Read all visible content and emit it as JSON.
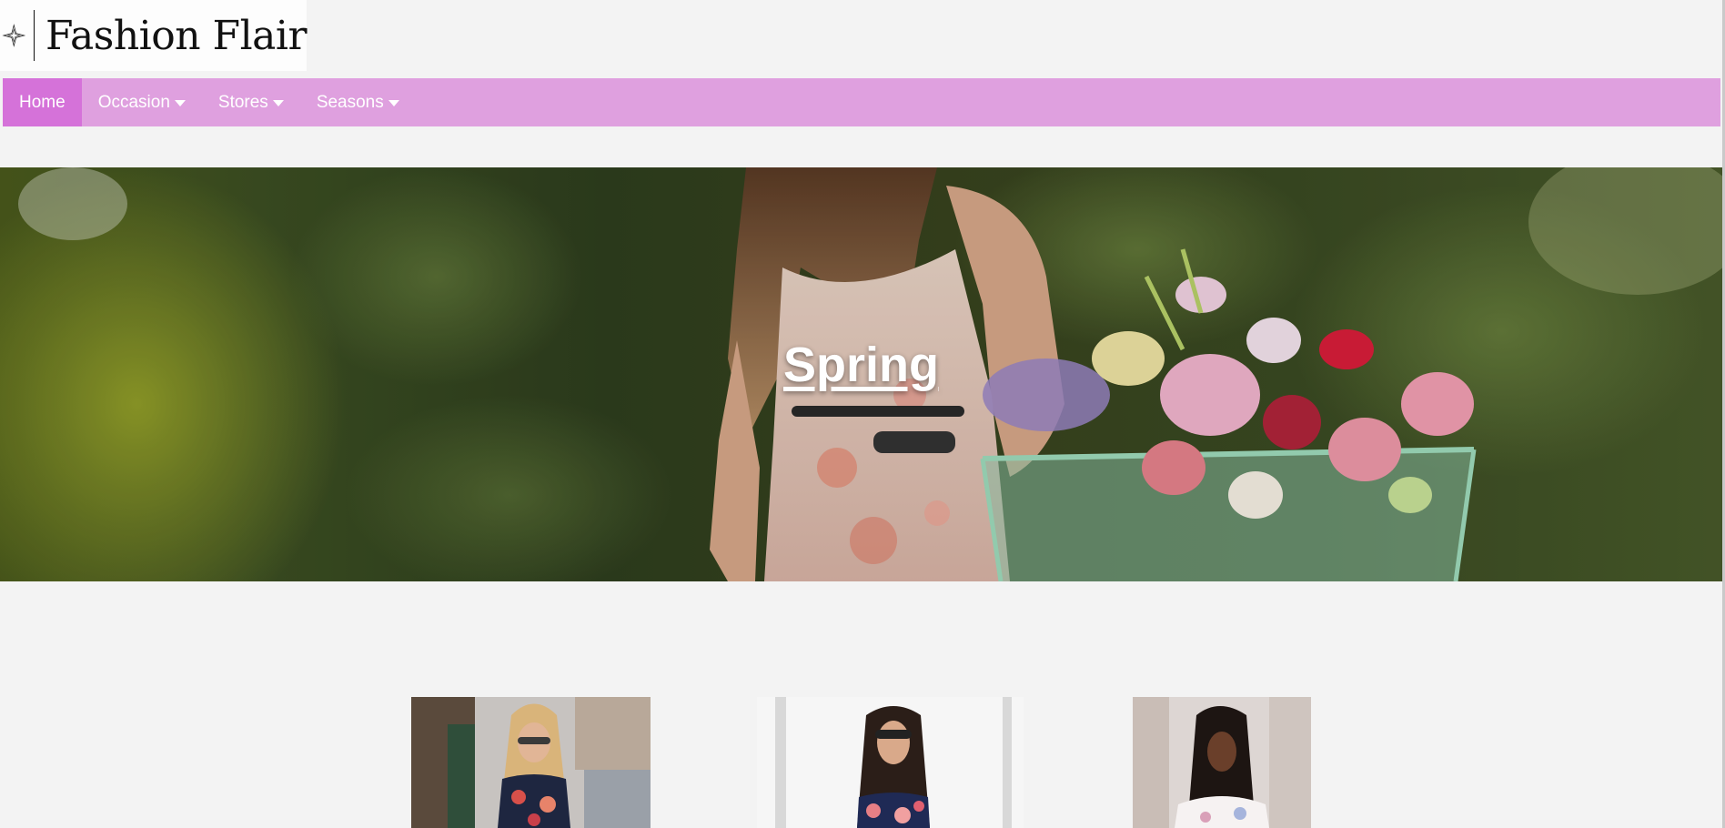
{
  "brand": {
    "name": "Fashion Flair",
    "logo_icon": "four-point-star-icon"
  },
  "nav": {
    "items": [
      {
        "label": "Home",
        "active": true,
        "has_dropdown": false
      },
      {
        "label": "Occasion",
        "active": false,
        "has_dropdown": true
      },
      {
        "label": "Stores",
        "active": false,
        "has_dropdown": true
      },
      {
        "label": "Seasons",
        "active": false,
        "has_dropdown": true
      }
    ],
    "bar_color": "#dfa0df",
    "active_color": "#d572d9"
  },
  "hero": {
    "title": "Spring"
  },
  "gallery": {
    "items": [
      {
        "photo": "woman-sunglasses-floral-top-street"
      },
      {
        "photo": "woman-sunglasses-floral-off-shoulder-top"
      },
      {
        "photo": "woman-white-floral-off-shoulder-top"
      }
    ]
  }
}
